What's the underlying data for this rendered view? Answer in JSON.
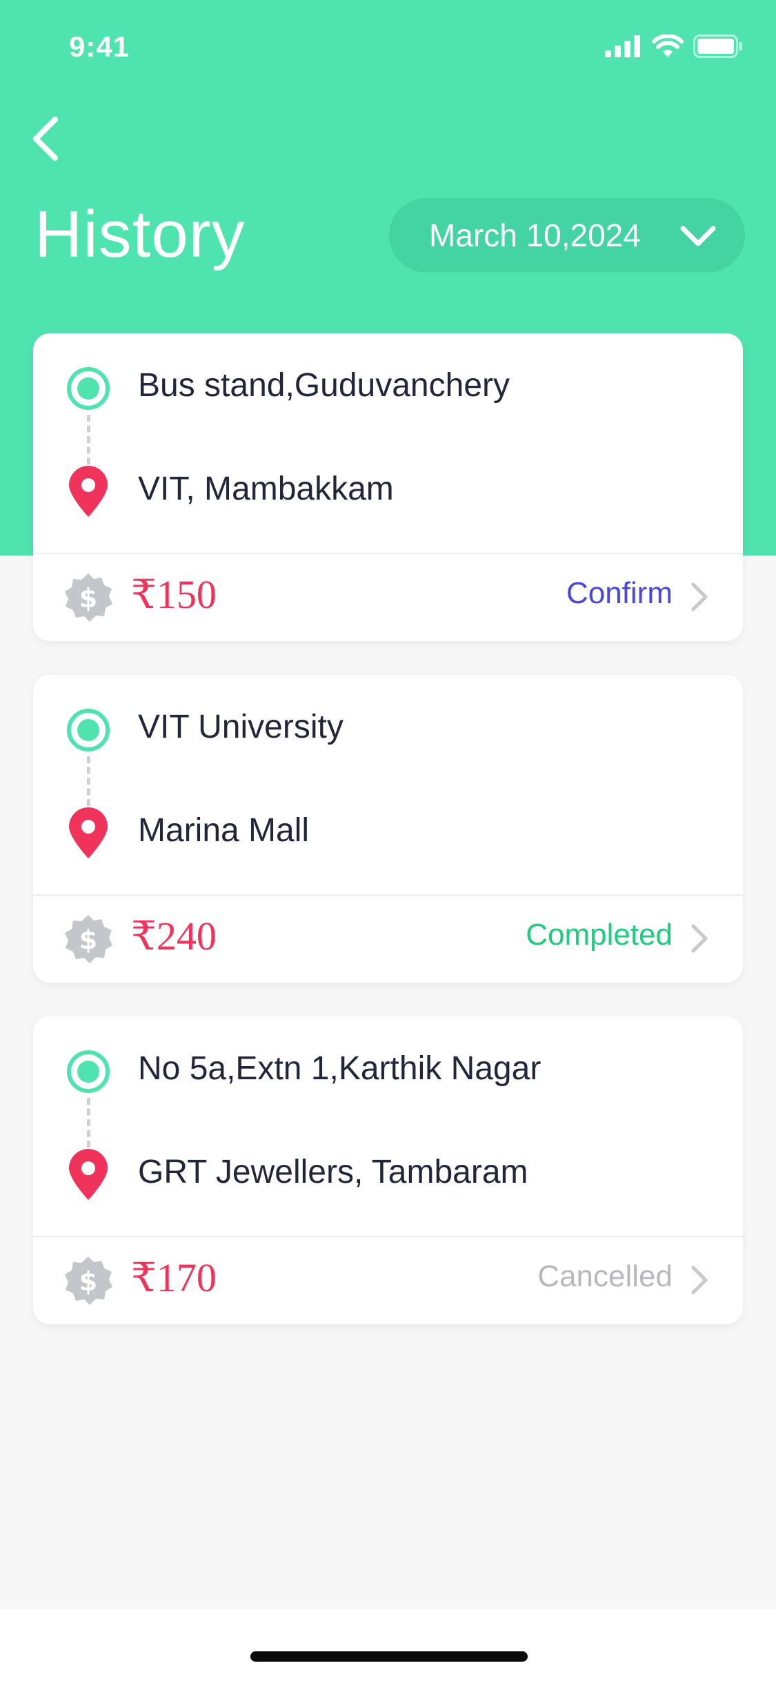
{
  "status_bar": {
    "time": "9:41"
  },
  "header": {
    "title": "History",
    "date_filter": "March 10,2024"
  },
  "colors": {
    "header_green": "#4fe3b0",
    "price_red": "#f0335a",
    "status_confirm": "#4a47e0",
    "status_completed": "#1fcc7e",
    "status_cancelled": "#b8b8bf"
  },
  "trips": [
    {
      "from": "Bus stand,Guduvanchery",
      "to": "VIT, Mambakkam",
      "price": "₹150",
      "status": "Confirm"
    },
    {
      "from": "VIT University",
      "to": "Marina Mall",
      "price": "₹240",
      "status": "Completed"
    },
    {
      "from": "No 5a,Extn 1,Karthik Nagar",
      "to": "GRT Jewellers, Tambaram",
      "price": "₹170",
      "status": "Cancelled"
    }
  ],
  "icons": {
    "back": "chevron-left-icon",
    "dropdown": "chevron-down-icon",
    "origin": "origin-circle-icon",
    "destination": "location-pin-icon",
    "fare": "dollar-coin-icon",
    "detail": "chevron-right-icon"
  }
}
